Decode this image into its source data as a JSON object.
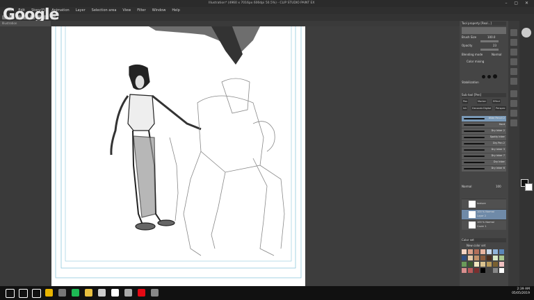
{
  "window": {
    "title": "Illustration* (4960 x 7016px 600dpi 50.5%) - CLIP STUDIO PAINT EX"
  },
  "menu": [
    "File",
    "Edit",
    "Story(P)",
    "Animation",
    "Layer",
    "Selection area",
    "View",
    "Filter",
    "Window",
    "Help"
  ],
  "doc_tab": "Illustration",
  "watermark": "Google",
  "brush_panel": {
    "header": "Tool property [Real...]",
    "brush_size_label": "Brush Size",
    "brush_size_value": "100.0",
    "opacity_label": "Opacity",
    "opacity_value": "23",
    "blending_label": "Blending mode",
    "blending_value": "Normal",
    "color_mixing_label": "Color mixing",
    "stabilization_label": "Stabilization"
  },
  "subtool_header": "Sub tool [Pen]",
  "subtool_tabs": [
    "Pen",
    "Marker",
    "Effect",
    "Ink",
    "Decorate",
    "Digital",
    "Perspec"
  ],
  "brushes": [
    "Wide Pencil 2",
    "Hard",
    "Dry Inker 2",
    "Spotty Inker",
    "Dry Pen 2",
    "Dry Inker 3",
    "Dry Inker 7",
    "Dry Inker",
    "Dry Inker 6"
  ],
  "layer_panel": {
    "blend": "Normal",
    "opacity": "100",
    "layers": [
      {
        "name": "texture",
        "desc": ""
      },
      {
        "name": "Layer 2",
        "desc": "100 % Normal"
      },
      {
        "name": "Cover 1",
        "desc": "100 % Normal"
      }
    ]
  },
  "color_set": {
    "header": "Color set",
    "name": "New color set"
  },
  "color_swatches": [
    "#f4d3c2",
    "#d9a089",
    "#b26e5a",
    "#e8b4a0",
    "#c7d7e8",
    "#8fb3d9",
    "#5a86b8",
    "#2f4d80",
    "#e6c9a8",
    "#c2906a",
    "#8a5a3c",
    "#4a2e20",
    "#d9e8c7",
    "#a8c78f",
    "#6a9a5a",
    "#3c5a30",
    "#f0e6c0",
    "#d9c28f",
    "#b89a5a",
    "#7a6030",
    "#f0c0c0",
    "#d98f8f",
    "#b85a5a",
    "#7a2f2f",
    "#000000",
    "#444444",
    "#888888",
    "#ffffff"
  ],
  "taskbar": {
    "icons": [
      {
        "name": "windows-icon",
        "color": "#ffffff"
      },
      {
        "name": "search-icon",
        "color": "#ffffff"
      },
      {
        "name": "task-view-icon",
        "color": "#ffffff"
      },
      {
        "name": "chrome-icon",
        "color": "#e8b400"
      },
      {
        "name": "gmail-icon",
        "color": "#777777"
      },
      {
        "name": "spotify-icon",
        "color": "#1db954"
      },
      {
        "name": "explorer-icon",
        "color": "#e8c040"
      },
      {
        "name": "mail-icon",
        "color": "#cccccc"
      },
      {
        "name": "obs-icon",
        "color": "#ffffff"
      },
      {
        "name": "clipstudio-icon",
        "color": "#aaaaaa"
      },
      {
        "name": "netflix-icon",
        "color": "#e50914"
      },
      {
        "name": "app-icon",
        "color": "#888888"
      }
    ],
    "time": "2:39 AM",
    "date": "05/05/2019"
  }
}
